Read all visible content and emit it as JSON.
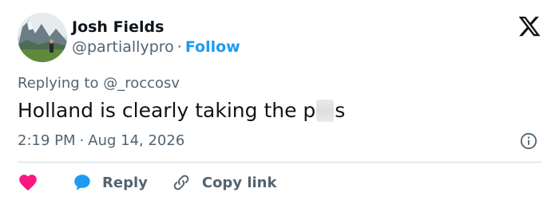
{
  "author": {
    "name": "Josh Fields",
    "handle": "@partiallypro",
    "separator": "·",
    "follow_label": "Follow"
  },
  "reply_context": {
    "prefix": "Replying to",
    "target": "@_roccosv"
  },
  "tweet": {
    "text_before": "Holland is clearly taking the p",
    "text_after": "s"
  },
  "meta": {
    "time": "2:19 PM",
    "separator": "·",
    "date": "Aug 14, 2026"
  },
  "actions": {
    "reply_label": "Reply",
    "copy_link_label": "Copy link"
  },
  "colors": {
    "accent": "#1d9bf0",
    "like": "#f91880",
    "muted": "#536471",
    "divider": "#cfd9de"
  },
  "icons": [
    "x-logo-icon",
    "info-icon",
    "heart-icon",
    "reply-bubble-icon",
    "link-icon"
  ]
}
